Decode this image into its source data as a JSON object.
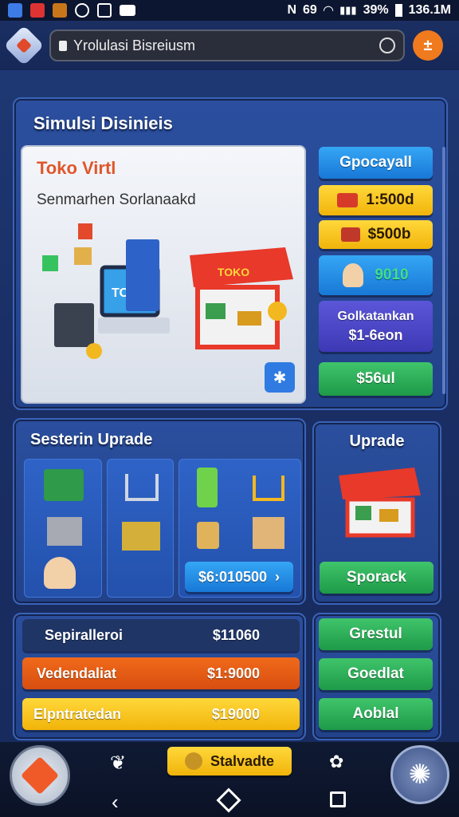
{
  "status": {
    "right_text_1": "69",
    "battery": "39%",
    "data": "136.1M"
  },
  "browser": {
    "url_text": "Yrolulasi Bisreiusm"
  },
  "main": {
    "title": "Simulsi Disinieis",
    "shop": {
      "title": "Toko Virtl",
      "subtitle": "Senmarhen Sorlanaakd",
      "screen_text": "TOKO",
      "stall_text": "TOKO"
    },
    "side_buttons": [
      {
        "label": "Gpocayall",
        "color": "blue"
      },
      {
        "label": "1:500d",
        "color": "yellow"
      },
      {
        "label": "$500b",
        "color": "yellow"
      },
      {
        "label": "9010",
        "color": "blue"
      },
      {
        "label": "Golkatankan",
        "sub": "$1-6eon",
        "color": "purple"
      },
      {
        "label": "$56ul",
        "color": "green"
      }
    ]
  },
  "upgrade": {
    "title": "Sesterin Uprade",
    "price_button": "$6:010500",
    "side_title": "Uprade",
    "side_button": "Sporack"
  },
  "bottom": {
    "rows": [
      {
        "label": "Sepiralleroi",
        "value": "$11060",
        "color": "navy"
      },
      {
        "label": "Vedendaliat",
        "value": "$1:9000",
        "color": "orange"
      },
      {
        "label": "Elpntratedan",
        "value": "$19000",
        "color": "yellow"
      }
    ],
    "right_buttons": [
      "Grestul",
      "Goedlat",
      "Aoblal"
    ]
  },
  "nav": {
    "center_label": "Stalvadte"
  }
}
